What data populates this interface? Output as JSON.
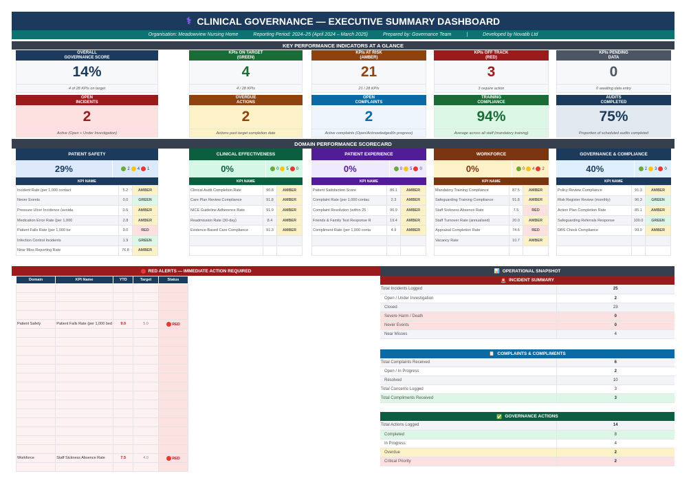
{
  "header": {
    "icon": "caduceus-icon",
    "title": "CLINICAL GOVERNANCE  —  EXECUTIVE SUMMARY DASHBOARD",
    "organisation": "Organisation:  Meadowview Nursing Home",
    "period": "Reporting Period:  2024–25  (April 2024 – March 2025)",
    "prepared": "Prepared by:  Governance Team",
    "sep": "|",
    "developed": "Developed by Novatib Ltd"
  },
  "kpi_band": "KEY PERFORMANCE INDICATORS AT A GLANCE",
  "kpis": [
    {
      "l1": "OVERALL",
      "l2": "GOVERNANCE SCORE",
      "value": "14%",
      "foot": "4 of 28 KPIs on target",
      "head": "#1b3a5c",
      "bg": "#f7f8fa",
      "fg": "#1b3a5c"
    },
    {
      "l1": "KPIs ON TARGET",
      "l2": "(GREEN)",
      "value": "4",
      "foot": "4 / 28 KPIs",
      "head": "#1a6b35",
      "bg": "#f7f8fa",
      "fg": "#1a6b35"
    },
    {
      "l1": "KPIs AT RISK",
      "l2": "(AMBER)",
      "value": "21",
      "foot": "21 / 28 KPIs",
      "head": "#8e420f",
      "bg": "#f7f8fa",
      "fg": "#8e420f"
    },
    {
      "l1": "KPIs OFF TRACK",
      "l2": "(RED)",
      "value": "3",
      "foot": "3 require action",
      "head": "#991b1b",
      "bg": "#f7f8fa",
      "fg": "#991b1b"
    },
    {
      "l1": "KPIs PENDING",
      "l2": "DATA",
      "value": "0",
      "foot": "0 awaiting data entry",
      "head": "#4b5563",
      "bg": "#f7f8fa",
      "fg": "#4b5563"
    },
    {
      "l1": "OPEN",
      "l2": "INCIDENTS",
      "value": "2",
      "foot": "Active (Open + Under Investigation)",
      "head": "#991b1b",
      "bg": "#fde0e0",
      "fg": "#991b1b"
    },
    {
      "l1": "OVERDUE",
      "l2": "ACTIONS",
      "value": "2",
      "foot": "Actions past target completion date",
      "head": "#8e420f",
      "bg": "#fdf1c7",
      "fg": "#8e420f"
    },
    {
      "l1": "OPEN",
      "l2": "COMPLAINTS",
      "value": "2",
      "foot": "Active complaints (Open/Acknowledged/In progress)",
      "head": "#0b69a3",
      "bg": "#eef5fd",
      "fg": "#0b69a3"
    },
    {
      "l1": "TRAINING",
      "l2": "COMPLIANCE",
      "value": "94%",
      "foot": "Average across all staff (mandatory training)",
      "head": "#1a6b35",
      "bg": "#dcf7e5",
      "fg": "#1a6b35"
    },
    {
      "l1": "AUDITS",
      "l2": "COMPLETED",
      "value": "75%",
      "foot": "Proportion of scheduled audits completed",
      "head": "#1b3a5c",
      "bg": "#e2e8f0",
      "fg": "#1b3a5c"
    }
  ],
  "domain_band": "DOMAIN PERFORMANCE SCORECARD",
  "kpi_col": "KPI NAME",
  "domains": [
    {
      "name": "PATIENT SAFETY",
      "score": "29%",
      "green": "2",
      "amber": "4",
      "red": "1",
      "head": "#1b3a5c",
      "bg": "#dbe9fb",
      "fg": "#1b3a5c",
      "rows": [
        [
          "Incident Rate (per 1,000 contact",
          "5.2",
          "AMBER"
        ],
        [
          "Never Events",
          "0.0",
          "GREEN"
        ],
        [
          "Pressure Ulcer Incidence (avoida",
          "0.5",
          "AMBER"
        ],
        [
          "Medication Error Rate (per 1,000",
          "2.8",
          "AMBER"
        ],
        [
          "Patient Falls Rate (per 1,000 be",
          "9.0",
          "RED"
        ],
        [
          "Infection Control Incidents",
          "1.9",
          "GREEN"
        ],
        [
          "Near Miss Reporting Rate",
          "76.8",
          "AMBER"
        ]
      ]
    },
    {
      "name": "CLINICAL EFFECTIVENESS",
      "score": "0%",
      "green": "0",
      "amber": "5",
      "red": "0",
      "head": "#0b5e40",
      "bg": "#d5f8e6",
      "fg": "#0b5e40",
      "rows": [
        [
          "Clinical Audit Completion Rate",
          "90.8",
          "AMBER"
        ],
        [
          "Care Plan Review Compliance",
          "91.8",
          "AMBER"
        ],
        [
          "NICE Guideline Adherence Rate",
          "91.9",
          "AMBER"
        ],
        [
          "Readmission Rate (30-day)",
          "8.4",
          "AMBER"
        ],
        [
          "Evidence-Based Care Compliance",
          "91.3",
          "AMBER"
        ],
        [
          "",
          "",
          ""
        ],
        [
          "",
          "",
          ""
        ]
      ]
    },
    {
      "name": "PATIENT EXPERIENCE",
      "score": "0%",
      "green": "0",
      "amber": "5",
      "red": "0",
      "head": "#521c97",
      "bg": "#efeafd",
      "fg": "#521c97",
      "rows": [
        [
          "Patient Satisfaction Score",
          "86.1",
          "AMBER"
        ],
        [
          "Complaint Rate (per 1,000 contac",
          "2.3",
          "AMBER"
        ],
        [
          "Complaint Resolution (within 25",
          "90.9",
          "AMBER"
        ],
        [
          "Friends & Family Test Response R",
          "19.4",
          "AMBER"
        ],
        [
          "Compliment Rate (per 1,000 conta",
          "4.9",
          "AMBER"
        ],
        [
          "",
          "",
          ""
        ],
        [
          "",
          "",
          ""
        ]
      ]
    },
    {
      "name": "WORKFORCE",
      "score": "0%",
      "green": "0",
      "amber": "4",
      "red": "2",
      "head": "#7a3510",
      "bg": "#fdf1c7",
      "fg": "#7a3510",
      "rows": [
        [
          "Mandatory Training Compliance",
          "87.5",
          "AMBER"
        ],
        [
          "Safeguarding Training Compliance",
          "91.8",
          "AMBER"
        ],
        [
          "Staff Sickness Absence Rate",
          "7.5",
          "RED"
        ],
        [
          "Staff Turnover Rate (annualised)",
          "20.0",
          "AMBER"
        ],
        [
          "Appraisal Completion Rate",
          "74.6",
          "RED"
        ],
        [
          "Vacancy Rate",
          "10.7",
          "AMBER"
        ],
        [
          "",
          "",
          ""
        ]
      ]
    },
    {
      "name": "GOVERNANCE & COMPLIANCE",
      "score": "40%",
      "green": "2",
      "amber": "3",
      "red": "0",
      "head": "#1b3a5c",
      "bg": "#e0effd",
      "fg": "#1b3a5c",
      "rows": [
        [
          "Policy Review Compliance",
          "91.3",
          "AMBER"
        ],
        [
          "Risk Register Review (monthly)",
          "96.3",
          "GREEN"
        ],
        [
          "Action Plan Completion Rate",
          "85.1",
          "AMBER"
        ],
        [
          "Safeguarding Referrals Response",
          "100.0",
          "GREEN"
        ],
        [
          "DBS Check Compliance",
          "99.0",
          "AMBER"
        ],
        [
          "",
          "",
          ""
        ],
        [
          "",
          "",
          ""
        ]
      ]
    }
  ],
  "alerts": {
    "title": "RED ALERTS — IMMEDIATE ACTION REQUIRED",
    "columns": [
      "Domain",
      "KPI Name",
      "YTD",
      "Target",
      "Status"
    ],
    "rows": [
      [
        "",
        "",
        "",
        "",
        ""
      ],
      [
        "",
        "",
        "",
        "",
        ""
      ],
      [
        "",
        "",
        "",
        "",
        ""
      ],
      [
        "",
        "",
        "",
        "",
        ""
      ],
      [
        "Patient Safety",
        "Patient Falls Rate (per 1,000 bed",
        "9.0",
        "5.0",
        "RED"
      ],
      [
        "",
        "",
        "",
        "",
        ""
      ],
      [
        "",
        "",
        "",
        "",
        ""
      ],
      [
        "",
        "",
        "",
        "",
        ""
      ],
      [
        "",
        "",
        "",
        "",
        ""
      ],
      [
        "",
        "",
        "",
        "",
        ""
      ],
      [
        "",
        "",
        "",
        "",
        ""
      ],
      [
        "",
        "",
        "",
        "",
        ""
      ],
      [
        "",
        "",
        "",
        "",
        ""
      ],
      [
        "",
        "",
        "",
        "",
        ""
      ],
      [
        "",
        "",
        "",
        "",
        ""
      ],
      [
        "",
        "",
        "",
        "",
        ""
      ],
      [
        "",
        "",
        "",
        "",
        ""
      ],
      [
        "",
        "",
        "",
        "",
        ""
      ],
      [
        "",
        "",
        "",
        "",
        ""
      ],
      [
        "Workforce",
        "Staff Sickness Absence Rate",
        "7.5",
        "4.0",
        "RED"
      ],
      [
        "",
        "",
        "",
        "",
        ""
      ]
    ]
  },
  "snapshot": {
    "title": "OPERATIONAL SNAPSHOT",
    "icon": "bar-chart-icon",
    "sections": [
      {
        "title": "INCIDENT SUMMARY",
        "icon": "siren-icon",
        "color": "#991b1b",
        "rows": [
          [
            "Total Incidents Logged",
            "25",
            "g",
            0,
            1
          ],
          [
            "Open / Under Investigation",
            "2",
            "w",
            1,
            1
          ],
          [
            "Closed",
            "23",
            "g",
            1,
            0
          ],
          [
            "Severe Harm / Death",
            "0",
            "r",
            1,
            1
          ],
          [
            "Never Events",
            "0",
            "r",
            1,
            1
          ],
          [
            "Near Misses",
            "4",
            "g",
            1,
            0
          ]
        ]
      },
      {
        "title": "COMPLAINTS & COMPLIMENTS",
        "icon": "clipboard-icon",
        "color": "#0b69a3",
        "rows": [
          [
            "Total Complaints Received",
            "6",
            "g",
            0,
            1
          ],
          [
            "Open / In Progress",
            "2",
            "w",
            1,
            1
          ],
          [
            "Resolved",
            "10",
            "g",
            1,
            0
          ],
          [
            "Total Concerns Logged",
            "3",
            "w",
            0,
            0
          ],
          [
            "Total Compliments Received",
            "3",
            "gr",
            0,
            1
          ]
        ]
      },
      {
        "title": "GOVERNANCE ACTIONS",
        "icon": "check-box-icon",
        "color": "#0b5e40",
        "rows": [
          [
            "Total Actions Logged",
            "14",
            "g",
            0,
            1
          ],
          [
            "Completed",
            "8",
            "gr",
            1,
            0
          ],
          [
            "In Progress",
            "4",
            "w",
            1,
            0
          ],
          [
            "Overdue",
            "2",
            "y",
            1,
            1
          ],
          [
            "Critical Priority",
            "2",
            "r",
            1,
            1
          ]
        ]
      }
    ]
  },
  "colors": {
    "green_dot": "#6aaa3a",
    "amber_dot": "#f5c518",
    "red_dot": "#e53935"
  }
}
